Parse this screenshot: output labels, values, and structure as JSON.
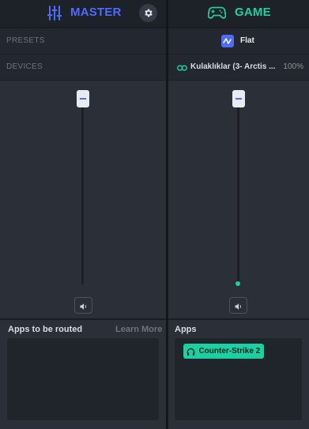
{
  "colors": {
    "master_accent": "#4d6bff",
    "game_accent": "#19d1a2",
    "background": "#1a1e24"
  },
  "master": {
    "title": "MASTER",
    "title_icon": "mixer-sliders-icon",
    "settings_icon": "gear-icon",
    "presets_label": "PRESETS",
    "devices_label": "DEVICES",
    "volume_percent": 100,
    "speaker_icon": "speaker-icon",
    "apps_title": "Apps to be routed",
    "learn_more": "Learn More"
  },
  "game": {
    "title": "GAME",
    "title_icon": "gamepad-icon",
    "preset_icon": "wave-preset-icon",
    "preset_name": "Flat",
    "device_icon": "link-icon",
    "device_name": "Kulaklıklar (3- Arctis ...",
    "device_volume": "100%",
    "volume_percent": 0,
    "speaker_icon": "speaker-icon",
    "apps_title": "Apps",
    "app_chip": "Counter-Strike 2",
    "app_chip_icon": "headphones-icon"
  }
}
